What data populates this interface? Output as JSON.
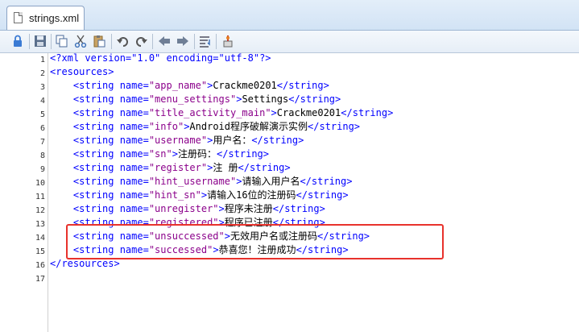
{
  "tab": {
    "title": "strings.xml"
  },
  "toolbar": {
    "icons": [
      "lock-icon",
      "save-icon",
      "copy-icon",
      "cut-icon",
      "paste-icon",
      "undo-icon",
      "redo-icon",
      "nav-back-icon",
      "nav-forward-icon",
      "word-wrap-icon",
      "compile-icon"
    ]
  },
  "editor": {
    "lines": [
      {
        "num": "1",
        "indent": "",
        "parts": [
          {
            "t": "<?xml version=\"1.0\" encoding=\"utf-8\"?>",
            "c": "tag"
          }
        ]
      },
      {
        "num": "2",
        "indent": "",
        "parts": [
          {
            "t": "<resources>",
            "c": "tag"
          }
        ]
      },
      {
        "num": "3",
        "indent": "    ",
        "parts": [
          {
            "t": "<string ",
            "c": "tag"
          },
          {
            "t": "name=",
            "c": "attr"
          },
          {
            "t": "\"app_name\"",
            "c": "val"
          },
          {
            "t": ">",
            "c": "tag"
          },
          {
            "t": "Crackme0201",
            "c": "txt"
          },
          {
            "t": "</string>",
            "c": "tag"
          }
        ]
      },
      {
        "num": "4",
        "indent": "    ",
        "parts": [
          {
            "t": "<string ",
            "c": "tag"
          },
          {
            "t": "name=",
            "c": "attr"
          },
          {
            "t": "\"menu_settings\"",
            "c": "val"
          },
          {
            "t": ">",
            "c": "tag"
          },
          {
            "t": "Settings",
            "c": "txt"
          },
          {
            "t": "</string>",
            "c": "tag"
          }
        ]
      },
      {
        "num": "5",
        "indent": "    ",
        "parts": [
          {
            "t": "<string ",
            "c": "tag"
          },
          {
            "t": "name=",
            "c": "attr"
          },
          {
            "t": "\"title_activity_main\"",
            "c": "val"
          },
          {
            "t": ">",
            "c": "tag"
          },
          {
            "t": "Crackme0201",
            "c": "txt"
          },
          {
            "t": "</string>",
            "c": "tag"
          }
        ]
      },
      {
        "num": "6",
        "indent": "    ",
        "parts": [
          {
            "t": "<string ",
            "c": "tag"
          },
          {
            "t": "name=",
            "c": "attr"
          },
          {
            "t": "\"info\"",
            "c": "val"
          },
          {
            "t": ">",
            "c": "tag"
          },
          {
            "t": "Android程序破解演示实例",
            "c": "txt"
          },
          {
            "t": "</string>",
            "c": "tag"
          }
        ]
      },
      {
        "num": "7",
        "indent": "    ",
        "parts": [
          {
            "t": "<string ",
            "c": "tag"
          },
          {
            "t": "name=",
            "c": "attr"
          },
          {
            "t": "\"username\"",
            "c": "val"
          },
          {
            "t": ">",
            "c": "tag"
          },
          {
            "t": "用户名：",
            "c": "txt"
          },
          {
            "t": "</string>",
            "c": "tag"
          }
        ]
      },
      {
        "num": "8",
        "indent": "    ",
        "parts": [
          {
            "t": "<string ",
            "c": "tag"
          },
          {
            "t": "name=",
            "c": "attr"
          },
          {
            "t": "\"sn\"",
            "c": "val"
          },
          {
            "t": ">",
            "c": "tag"
          },
          {
            "t": "注册码：",
            "c": "txt"
          },
          {
            "t": "</string>",
            "c": "tag"
          }
        ]
      },
      {
        "num": "9",
        "indent": "    ",
        "parts": [
          {
            "t": "<string ",
            "c": "tag"
          },
          {
            "t": "name=",
            "c": "attr"
          },
          {
            "t": "\"register\"",
            "c": "val"
          },
          {
            "t": ">",
            "c": "tag"
          },
          {
            "t": "注 册",
            "c": "txt"
          },
          {
            "t": "</string>",
            "c": "tag"
          }
        ]
      },
      {
        "num": "10",
        "indent": "    ",
        "parts": [
          {
            "t": "<string ",
            "c": "tag"
          },
          {
            "t": "name=",
            "c": "attr"
          },
          {
            "t": "\"hint_username\"",
            "c": "val"
          },
          {
            "t": ">",
            "c": "tag"
          },
          {
            "t": "请输入用户名",
            "c": "txt"
          },
          {
            "t": "</string>",
            "c": "tag"
          }
        ]
      },
      {
        "num": "11",
        "indent": "    ",
        "parts": [
          {
            "t": "<string ",
            "c": "tag"
          },
          {
            "t": "name=",
            "c": "attr"
          },
          {
            "t": "\"hint_sn\"",
            "c": "val"
          },
          {
            "t": ">",
            "c": "tag"
          },
          {
            "t": "请输入16位的注册码",
            "c": "txt"
          },
          {
            "t": "</string>",
            "c": "tag"
          }
        ]
      },
      {
        "num": "12",
        "indent": "    ",
        "parts": [
          {
            "t": "<string ",
            "c": "tag"
          },
          {
            "t": "name=",
            "c": "attr"
          },
          {
            "t": "\"unregister\"",
            "c": "val"
          },
          {
            "t": ">",
            "c": "tag"
          },
          {
            "t": "程序未注册",
            "c": "txt"
          },
          {
            "t": "</string>",
            "c": "tag"
          }
        ]
      },
      {
        "num": "13",
        "indent": "    ",
        "parts": [
          {
            "t": "<string ",
            "c": "tag"
          },
          {
            "t": "name=",
            "c": "attr"
          },
          {
            "t": "\"registered\"",
            "c": "val"
          },
          {
            "t": ">",
            "c": "tag"
          },
          {
            "t": "程序已注册",
            "c": "txt"
          },
          {
            "t": "</string>",
            "c": "tag"
          }
        ]
      },
      {
        "num": "14",
        "indent": "    ",
        "parts": [
          {
            "t": "<string ",
            "c": "tag"
          },
          {
            "t": "name=",
            "c": "attr"
          },
          {
            "t": "\"unsuccessed\"",
            "c": "val"
          },
          {
            "t": ">",
            "c": "tag"
          },
          {
            "t": "无效用户名或注册码",
            "c": "txt"
          },
          {
            "t": "</string>",
            "c": "tag"
          }
        ]
      },
      {
        "num": "15",
        "indent": "    ",
        "parts": [
          {
            "t": "<string ",
            "c": "tag"
          },
          {
            "t": "name=",
            "c": "attr"
          },
          {
            "t": "\"successed\"",
            "c": "val"
          },
          {
            "t": ">",
            "c": "tag"
          },
          {
            "t": "恭喜您！注册成功",
            "c": "txt"
          },
          {
            "t": "</string>",
            "c": "tag"
          }
        ]
      },
      {
        "num": "16",
        "indent": "",
        "parts": [
          {
            "t": "</resources>",
            "c": "tag"
          }
        ]
      },
      {
        "num": "17",
        "indent": "",
        "parts": []
      }
    ]
  },
  "highlight": {
    "color": "#e8322c"
  }
}
